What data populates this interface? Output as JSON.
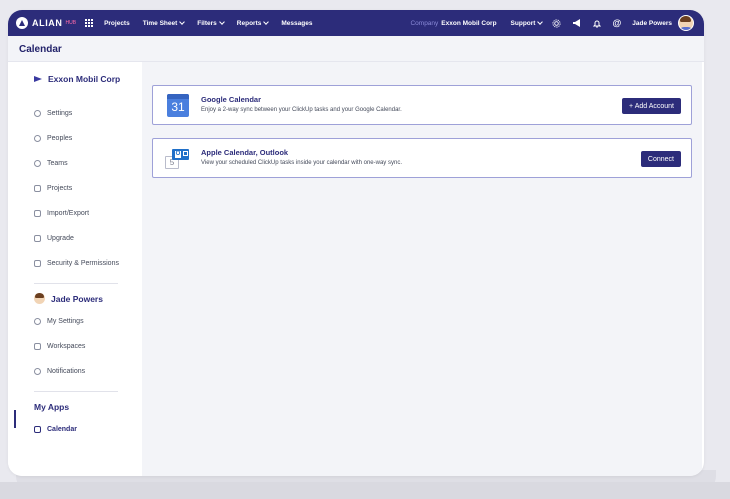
{
  "topbar": {
    "brand": "ALIAN",
    "version": "HUB",
    "nav": [
      {
        "label": "Projects",
        "dropdown": false
      },
      {
        "label": "Time Sheet",
        "dropdown": true
      },
      {
        "label": "Filters",
        "dropdown": true
      },
      {
        "label": "Reports",
        "dropdown": true
      },
      {
        "label": "Messages",
        "dropdown": false
      }
    ],
    "company_label": "Company",
    "company_value": "Exxon Mobil Corp",
    "support_label": "Support",
    "user_name": "Jade Powers",
    "icons": [
      "gear-icon",
      "megaphone-icon",
      "bell-icon",
      "at-icon"
    ]
  },
  "page": {
    "title": "Calendar"
  },
  "sidebar": {
    "org_name": "Exxon Mobil Corp",
    "org_items": [
      {
        "label": "Settings",
        "icon": "gear-icon"
      },
      {
        "label": "Peoples",
        "icon": "people-icon"
      },
      {
        "label": "Teams",
        "icon": "teams-icon"
      },
      {
        "label": "Projects",
        "icon": "projects-icon"
      },
      {
        "label": "Import/Export",
        "icon": "import-icon"
      },
      {
        "label": "Upgrade",
        "icon": "upgrade-icon"
      },
      {
        "label": "Security & Permissions",
        "icon": "shield-icon"
      }
    ],
    "user_name": "Jade Powers",
    "user_items": [
      {
        "label": "My Settings",
        "icon": "gear-icon"
      },
      {
        "label": "Workspaces",
        "icon": "workspace-icon"
      },
      {
        "label": "Notifications",
        "icon": "bell-icon"
      }
    ],
    "apps_heading": "My Apps",
    "apps_items": [
      {
        "label": "Calendar",
        "icon": "calendar-icon",
        "active": true
      }
    ]
  },
  "integrations": [
    {
      "title": "Google Calendar",
      "description": "Enjoy a 2-way sync between your ClickUp tasks and your Google Calendar.",
      "button": "+ Add Account",
      "icon": "google-calendar-icon",
      "icon_text": "31"
    },
    {
      "title": "Apple Calendar, Outlook",
      "description": "View your scheduled ClickUp tasks inside your calendar with one-way sync.",
      "button": "Connect",
      "icon": "outlook-calendar-icon",
      "icon_text": "5",
      "icon_letter": "O"
    }
  ],
  "colors": {
    "primary": "#2c2c7a",
    "accent": "#ff6aa9",
    "background": "#f3f4f8"
  }
}
